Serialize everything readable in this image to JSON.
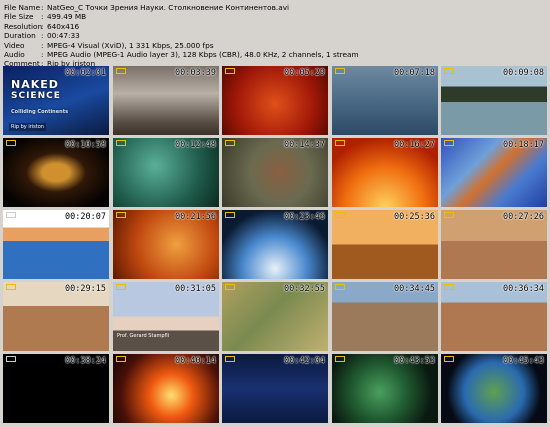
{
  "info": [
    {
      "key": "File Name",
      "value": "NatGeo_C Точки Зрения Науки. Столкновение Континентов.avi"
    },
    {
      "key": "File Size",
      "value": "499.49 MB"
    },
    {
      "key": "Resolution",
      "value": "640x416"
    },
    {
      "key": "Duration",
      "value": "00:47:33"
    },
    {
      "key": "Video",
      "value": "MPEG-4 Visual (XviD), 1 331 Kbps, 25.000 fps"
    },
    {
      "key": "Audio",
      "value": "MPEG Audio (MPEG-1 Audio layer 3), 128 Kbps (CBR), 48.0 KHz, 2 channels, 1 stream"
    },
    {
      "key": "Comment",
      "value": "Rip by iriston"
    }
  ],
  "thumbs": [
    {
      "time": "00:02:01",
      "scene": "title-card",
      "bg": "linear-gradient(160deg,#0a2060,#1a4aa0 55%,#0a1a40)"
    },
    {
      "time": "00:03:39",
      "scene": "geyser-steam",
      "bg": "linear-gradient(180deg,#7a7068,#b8b0a6 40%,#5a5048 80%,#3a3028)"
    },
    {
      "time": "00:05:29",
      "scene": "lava-red",
      "bg": "radial-gradient(circle at 50% 55%,#e0501a,#a01808 60%,#500800)"
    },
    {
      "time": "00:07:18",
      "scene": "ocean-water",
      "bg": "linear-gradient(180deg,#6f8aa0,#4a6a86 50%,#2c4a66)"
    },
    {
      "time": "00:09:08",
      "scene": "mountain-lake",
      "bg": "linear-gradient(180deg,#a9c2d2 0 30%,#2e3a2a 30% 52%,#7a9aa8 52% 100%)"
    },
    {
      "time": "00:10:58",
      "scene": "hourglass",
      "bg": "radial-gradient(ellipse at 50% 50%,#d09030 0 18%,#301808 40%,#050302 80%)"
    },
    {
      "time": "00:12:48",
      "scene": "green-bubbles",
      "bg": "radial-gradient(circle at 40% 40%,#5ab09a,#1f5a4a 60%,#0a2a20)"
    },
    {
      "time": "00:14:37",
      "scene": "rock-crack",
      "bg": "radial-gradient(circle at 55% 50%,#8a6040,#6a6a50 45%,#3a3a2a)"
    },
    {
      "time": "00:16:27",
      "scene": "earth-core",
      "bg": "radial-gradient(circle at 50% 100%,#ffd060,#f07010 45%,#b02000 80%)"
    },
    {
      "time": "00:18:17",
      "scene": "relief-map",
      "bg": "linear-gradient(135deg,#3050c0,#70a0d8 35%,#d07030 50%,#4a7ad0 70%,#2040a0)"
    },
    {
      "time": "00:20:07",
      "scene": "earth-layers",
      "bg": "linear-gradient(180deg,#ffffff 0 25%,#e8a060 25% 45%,#3070c0 45% 100%)"
    },
    {
      "time": "00:21:56",
      "scene": "fire-earth",
      "bg": "radial-gradient(circle at 60% 50%,#f0a040,#c04810 55%,#601800)"
    },
    {
      "time": "00:23:46",
      "scene": "earth-space",
      "bg": "radial-gradient(circle at 50% 85%,#e8f0f8,#4a8ad0 40%,#0a1a30 75%)"
    },
    {
      "time": "00:25:36",
      "scene": "desert-rock",
      "bg": "linear-gradient(180deg,#f0b060 0 50%,#a05a20 50% 100%)"
    },
    {
      "time": "00:27:26",
      "scene": "sandy-plain",
      "bg": "linear-gradient(180deg,#d0a070 0 45%,#b07850 45% 100%)"
    },
    {
      "time": "00:29:15",
      "scene": "canyon",
      "bg": "linear-gradient(180deg,#e6d8c0 0 35%,#b07a50 35% 100%)"
    },
    {
      "time": "00:31:05",
      "scene": "scientist-summit",
      "bg": "linear-gradient(180deg,#b8c8e0 0 50%,#e8d0c0 50% 70%,#5a5048 70% 100%)"
    },
    {
      "time": "00:32:55",
      "scene": "satellite-land",
      "bg": "linear-gradient(135deg,#b0a060,#7a8a50 45%,#c0b070)"
    },
    {
      "time": "00:34:45",
      "scene": "man-outdoors",
      "bg": "linear-gradient(180deg,#8aa8c8 0 30%,#9a7a5a 30% 100%)"
    },
    {
      "time": "00:36:34",
      "scene": "man-canyon",
      "bg": "linear-gradient(180deg,#a8c0d8 0 30%,#b07850 30% 100%)"
    },
    {
      "time": "00:38:24",
      "scene": "black-frame",
      "bg": "#000000"
    },
    {
      "time": "00:40:14",
      "scene": "volcano-eruption",
      "bg": "radial-gradient(circle at 55% 60%,#ffe070,#f05a10 30%,#4a1008 70%,#100404)"
    },
    {
      "time": "00:42:04",
      "scene": "seismograph",
      "bg": "linear-gradient(180deg,#0a1a40,#1a3070 50%,#0a1a40)"
    },
    {
      "time": "00:43:53",
      "scene": "globe-hud",
      "bg": "radial-gradient(circle at 45% 55%,#4aa060,#205a30 40%,#0a1a10 75%)"
    },
    {
      "time": "00:45:43",
      "scene": "globe-continents",
      "bg": "radial-gradient(circle at 50% 55%,#60a050,#2a6ab0 45%,#050a14 72%)"
    }
  ],
  "title_card": {
    "line1": "NAKED",
    "line2": "SCIENCE",
    "subtitle": "Colliding Continents",
    "caption": "Rip by iriston"
  },
  "scientist_caption": "Prof. Gerard Stampfli"
}
